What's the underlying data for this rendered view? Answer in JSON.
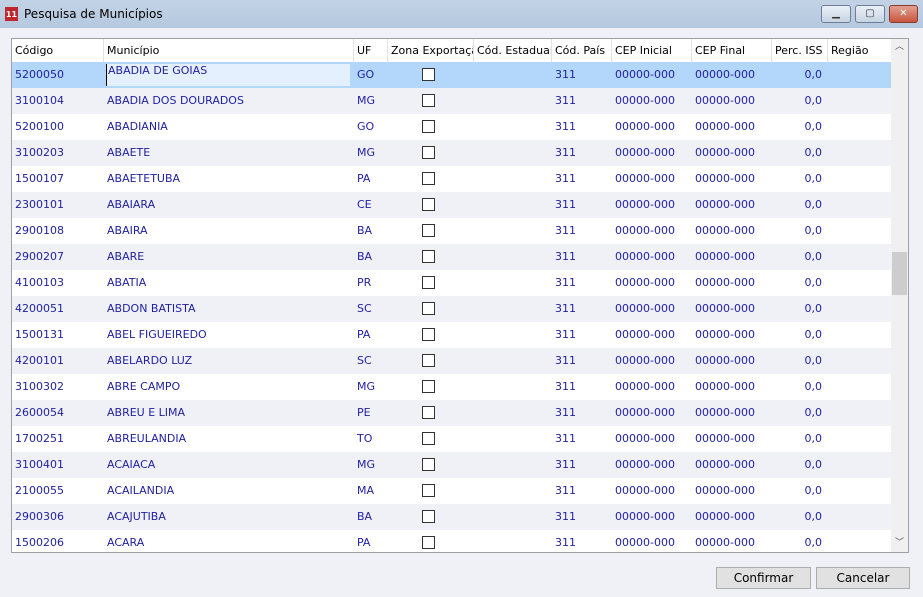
{
  "window": {
    "title": "Pesquisa de Municípios",
    "minimize": "▁",
    "maximize": "▢",
    "close": "✕"
  },
  "columns": [
    "Código",
    "Município",
    "UF",
    "Zona Exportação",
    "Cód. Estadual",
    "Cód. País",
    "CEP Inicial",
    "CEP Final",
    "Perc. ISS",
    "Região"
  ],
  "rows": [
    {
      "codigo": "5200050",
      "municipio": "ABADIA DE GOIAS",
      "uf": "GO",
      "zona": false,
      "estadual": "",
      "pais": "311",
      "cep_ini": "00000-000",
      "cep_fim": "00000-000",
      "iss": "0,0",
      "regiao": ""
    },
    {
      "codigo": "3100104",
      "municipio": "ABADIA DOS DOURADOS",
      "uf": "MG",
      "zona": false,
      "estadual": "",
      "pais": "311",
      "cep_ini": "00000-000",
      "cep_fim": "00000-000",
      "iss": "0,0",
      "regiao": ""
    },
    {
      "codigo": "5200100",
      "municipio": "ABADIANIA",
      "uf": "GO",
      "zona": false,
      "estadual": "",
      "pais": "311",
      "cep_ini": "00000-000",
      "cep_fim": "00000-000",
      "iss": "0,0",
      "regiao": ""
    },
    {
      "codigo": "3100203",
      "municipio": "ABAETE",
      "uf": "MG",
      "zona": false,
      "estadual": "",
      "pais": "311",
      "cep_ini": "00000-000",
      "cep_fim": "00000-000",
      "iss": "0,0",
      "regiao": ""
    },
    {
      "codigo": "1500107",
      "municipio": "ABAETETUBA",
      "uf": "PA",
      "zona": false,
      "estadual": "",
      "pais": "311",
      "cep_ini": "00000-000",
      "cep_fim": "00000-000",
      "iss": "0,0",
      "regiao": ""
    },
    {
      "codigo": "2300101",
      "municipio": "ABAIARA",
      "uf": "CE",
      "zona": false,
      "estadual": "",
      "pais": "311",
      "cep_ini": "00000-000",
      "cep_fim": "00000-000",
      "iss": "0,0",
      "regiao": ""
    },
    {
      "codigo": "2900108",
      "municipio": "ABAIRA",
      "uf": "BA",
      "zona": false,
      "estadual": "",
      "pais": "311",
      "cep_ini": "00000-000",
      "cep_fim": "00000-000",
      "iss": "0,0",
      "regiao": ""
    },
    {
      "codigo": "2900207",
      "municipio": "ABARE",
      "uf": "BA",
      "zona": false,
      "estadual": "",
      "pais": "311",
      "cep_ini": "00000-000",
      "cep_fim": "00000-000",
      "iss": "0,0",
      "regiao": ""
    },
    {
      "codigo": "4100103",
      "municipio": "ABATIA",
      "uf": "PR",
      "zona": false,
      "estadual": "",
      "pais": "311",
      "cep_ini": "00000-000",
      "cep_fim": "00000-000",
      "iss": "0,0",
      "regiao": ""
    },
    {
      "codigo": "4200051",
      "municipio": "ABDON BATISTA",
      "uf": "SC",
      "zona": false,
      "estadual": "",
      "pais": "311",
      "cep_ini": "00000-000",
      "cep_fim": "00000-000",
      "iss": "0,0",
      "regiao": ""
    },
    {
      "codigo": "1500131",
      "municipio": "ABEL FIGUEIREDO",
      "uf": "PA",
      "zona": false,
      "estadual": "",
      "pais": "311",
      "cep_ini": "00000-000",
      "cep_fim": "00000-000",
      "iss": "0,0",
      "regiao": ""
    },
    {
      "codigo": "4200101",
      "municipio": "ABELARDO LUZ",
      "uf": "SC",
      "zona": false,
      "estadual": "",
      "pais": "311",
      "cep_ini": "00000-000",
      "cep_fim": "00000-000",
      "iss": "0,0",
      "regiao": ""
    },
    {
      "codigo": "3100302",
      "municipio": "ABRE CAMPO",
      "uf": "MG",
      "zona": false,
      "estadual": "",
      "pais": "311",
      "cep_ini": "00000-000",
      "cep_fim": "00000-000",
      "iss": "0,0",
      "regiao": ""
    },
    {
      "codigo": "2600054",
      "municipio": "ABREU E LIMA",
      "uf": "PE",
      "zona": false,
      "estadual": "",
      "pais": "311",
      "cep_ini": "00000-000",
      "cep_fim": "00000-000",
      "iss": "0,0",
      "regiao": ""
    },
    {
      "codigo": "1700251",
      "municipio": "ABREULANDIA",
      "uf": "TO",
      "zona": false,
      "estadual": "",
      "pais": "311",
      "cep_ini": "00000-000",
      "cep_fim": "00000-000",
      "iss": "0,0",
      "regiao": ""
    },
    {
      "codigo": "3100401",
      "municipio": "ACAIACA",
      "uf": "MG",
      "zona": false,
      "estadual": "",
      "pais": "311",
      "cep_ini": "00000-000",
      "cep_fim": "00000-000",
      "iss": "0,0",
      "regiao": ""
    },
    {
      "codigo": "2100055",
      "municipio": "ACAILANDIA",
      "uf": "MA",
      "zona": false,
      "estadual": "",
      "pais": "311",
      "cep_ini": "00000-000",
      "cep_fim": "00000-000",
      "iss": "0,0",
      "regiao": ""
    },
    {
      "codigo": "2900306",
      "municipio": "ACAJUTIBA",
      "uf": "BA",
      "zona": false,
      "estadual": "",
      "pais": "311",
      "cep_ini": "00000-000",
      "cep_fim": "00000-000",
      "iss": "0,0",
      "regiao": ""
    },
    {
      "codigo": "1500206",
      "municipio": "ACARA",
      "uf": "PA",
      "zona": false,
      "estadual": "",
      "pais": "311",
      "cep_ini": "00000-000",
      "cep_fim": "00000-000",
      "iss": "0,0",
      "regiao": ""
    }
  ],
  "selected_row": 0,
  "scroll_position_percent": 45,
  "buttons": {
    "confirm": "Confirmar",
    "cancel": "Cancelar"
  },
  "colors": {
    "text": "#1f1fa0",
    "selection": "#b3d7fb",
    "alt_row": "#f0f1f7"
  }
}
